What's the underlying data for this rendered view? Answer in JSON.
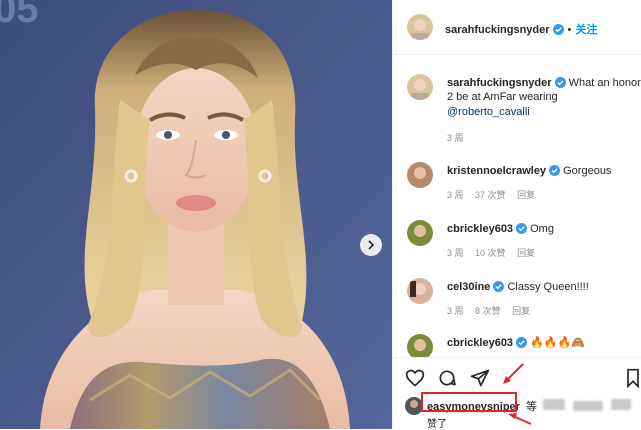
{
  "post": {
    "author": "sarahfuckingsnyder",
    "follow_label": "关注",
    "dot": "•",
    "caption_text": "What an honor",
    "caption_line2": "2 be at AmFar wearing",
    "caption_mention": "@roberto_cavalli",
    "caption_time": "3 周"
  },
  "comments": [
    {
      "user": "kristennoelcrawley",
      "text": "Gorgeous",
      "time": "3 周",
      "likes": "37 次赞",
      "reply": "回复"
    },
    {
      "user": "cbrickley603",
      "text": "Omg",
      "time": "3 周",
      "likes": "10 次赞",
      "reply": "回复"
    },
    {
      "user": "cel30ine",
      "text": "Classy Queen!!!!",
      "time": "3 周",
      "likes": "8 次赞",
      "reply": "回复"
    },
    {
      "user": "cbrickley603",
      "text": "🔥🔥🔥🙈",
      "time": "",
      "likes": "",
      "reply": ""
    }
  ],
  "liked_by": {
    "user": "easymoneysniper",
    "suffix": "等",
    "second_line": "赞了"
  },
  "icons": [
    "heart-icon",
    "comment-icon",
    "share-icon",
    "bookmark-icon",
    "verified-icon",
    "chevron-right-icon"
  ],
  "colors": {
    "accent": "#0095f6",
    "verified": "#3897f0",
    "highlight": "#e0262b",
    "photo_bg": "#4b5a86"
  }
}
